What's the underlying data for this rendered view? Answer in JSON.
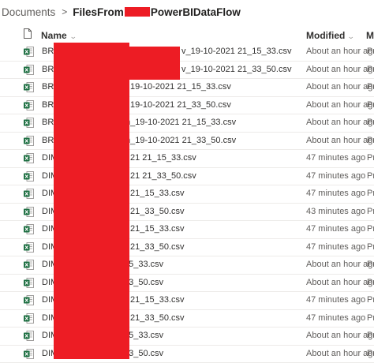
{
  "breadcrumb": {
    "root": "Documents",
    "separator": ">",
    "current_prefix": "FilesFrom",
    "current_suffix": "PowerBIDataFlow"
  },
  "columns": {
    "name": "Name",
    "modified": "Modified",
    "modified_by": "M"
  },
  "rows": [
    {
      "name": "BRID",
      "tail": "v_19-10-2021 21_15_33.csv",
      "modified": "About an hour ago",
      "by": "Pr"
    },
    {
      "name": "BRID",
      "tail": "v_19-10-2021 21_33_50.csv",
      "modified": "About an hour ago",
      "by": "Pr"
    },
    {
      "name": "BRID",
      "tail": "19-10-2021 21_15_33.csv",
      "modified": "About an hour ago",
      "by": "Pr"
    },
    {
      "name": "BRID",
      "tail": "19-10-2021 21_33_50.csv",
      "modified": "About an hour ago",
      "by": "Pr"
    },
    {
      "name": "BRID",
      "tail": "m_19-10-2021 21_15_33.csv",
      "modified": "About an hour ago",
      "by": "Pr"
    },
    {
      "name": "BRID",
      "tail": "m_19-10-2021 21_33_50.csv",
      "modified": "About an hour ago",
      "by": "Pr"
    },
    {
      "name": "DIM_",
      "tail": "21 21_15_33.csv",
      "modified": "47 minutes ago",
      "by": "Pr"
    },
    {
      "name": "DIM_",
      "tail": "21 21_33_50.csv",
      "modified": "47 minutes ago",
      "by": "Pr"
    },
    {
      "name": "DIM_",
      "tail": "21_15_33.csv",
      "modified": "47 minutes ago",
      "by": "Pr"
    },
    {
      "name": "DIM_",
      "tail": "21_33_50.csv",
      "modified": "43 minutes ago",
      "by": "Pr"
    },
    {
      "name": "DIM_",
      "tail": "21_15_33.csv",
      "modified": "47 minutes ago",
      "by": "Pr"
    },
    {
      "name": "DIM_",
      "tail": "21_33_50.csv",
      "modified": "47 minutes ago",
      "by": "Pr"
    },
    {
      "name": "DIM_",
      "tail": "15_33.csv",
      "modified": "About an hour ago",
      "by": "Pr"
    },
    {
      "name": "DIM_",
      "tail": "33_50.csv",
      "modified": "About an hour ago",
      "by": "Pr"
    },
    {
      "name": "DIM_",
      "tail": "21_15_33.csv",
      "modified": "47 minutes ago",
      "by": "Pr"
    },
    {
      "name": "DIM_",
      "tail": "21_33_50.csv",
      "modified": "47 minutes ago",
      "by": "Pr"
    },
    {
      "name": "DIM_",
      "tail": "15_33.csv",
      "modified": "About an hour ago",
      "by": "Pr"
    },
    {
      "name": "DIM_",
      "tail": "33_50.csv",
      "modified": "About an hour ago",
      "by": "Pr"
    }
  ],
  "colors": {
    "excel_green": "#1d6f42",
    "redaction": "#ed1c24",
    "divider": "#edebe9"
  },
  "icons": {
    "file_type": "excel-file-icon",
    "header_file": "file-type-header-icon",
    "sort": "chevron-down-icon"
  }
}
